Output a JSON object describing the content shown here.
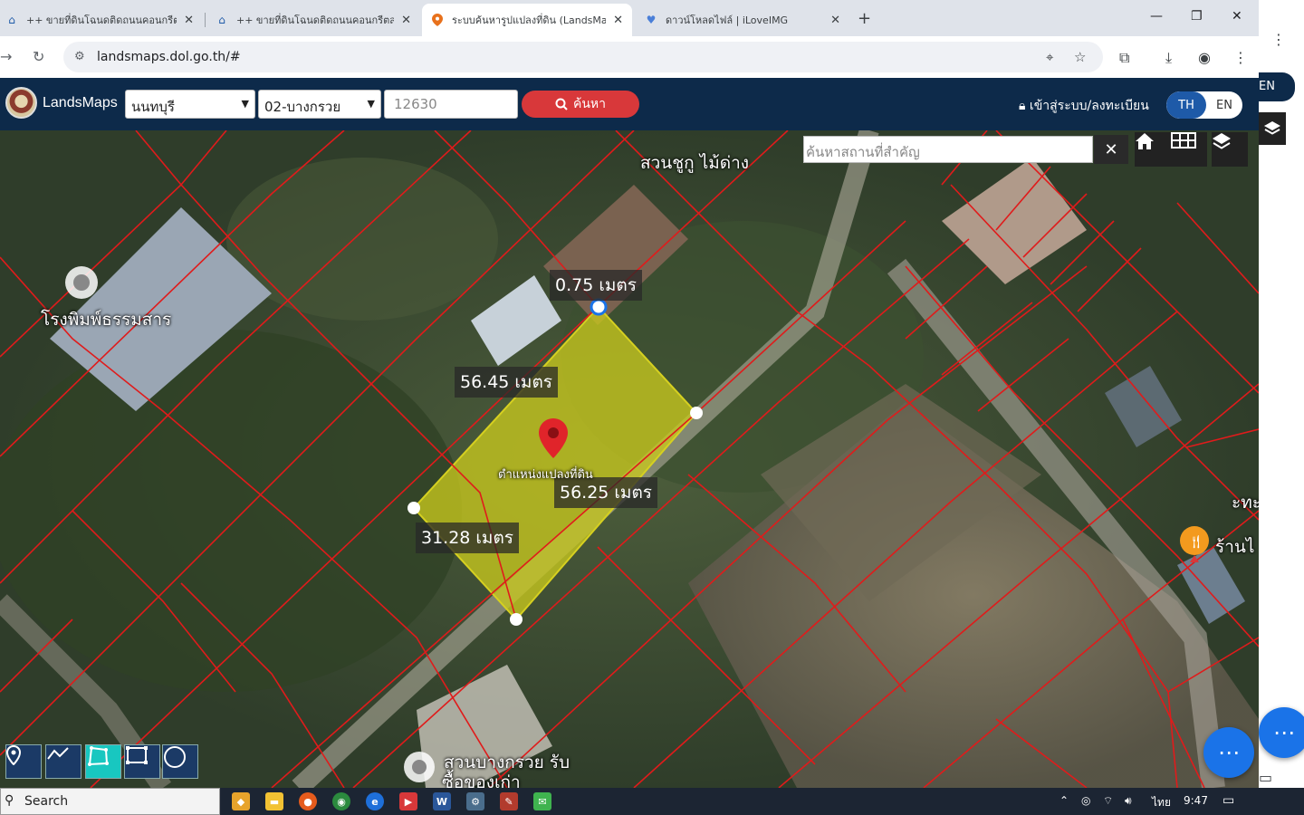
{
  "browser": {
    "tabs": [
      {
        "title": "++ ขายที่ดินโฉนดติดถนนคอนกรีตส",
        "icon": "home-icon"
      },
      {
        "title": "++ ขายที่ดินโฉนดติดถนนคอนกรีตส",
        "icon": "home-icon"
      },
      {
        "title": "ระบบค้นหารูปแปลงที่ดิน (LandsMap",
        "icon": "map-pin-icon"
      },
      {
        "title": "ดาวน์โหลดไฟล์ | iLoveIMG",
        "icon": "heart-icon"
      }
    ],
    "url": "landsmaps.dol.go.th/#"
  },
  "right_panel": {
    "lang": "EN"
  },
  "header": {
    "brand": "LandsMaps",
    "province": "นนทบุรี",
    "district": "02-บางกรวย",
    "zipcode": "12630",
    "search_label": "ค้นหา",
    "login_label": "เข้าสู่ระบบ/ลงทะเบียน",
    "lang_th": "TH",
    "lang_en": "EN"
  },
  "map": {
    "place_search_placeholder": "ค้นหาสถานที่สำคัญ",
    "measurements": {
      "top": "0.75 เมตร",
      "left": "56.45 เมตร",
      "right": "56.25 เมตร",
      "bottom": "31.28 เมตร"
    },
    "parcel_label": "ตำแหน่งแปลงที่ดิน",
    "pois": {
      "printing": "โรงพิมพ์ธรรมสาร",
      "garden_top": "สวนชูกู ไม้ด่าง",
      "garden_bottom_1": "สวนบางกรวย รับ",
      "garden_bottom_2": "ซื้อของเก่า",
      "shop": "ร้านไ",
      "edge_text": "ะทะ"
    },
    "parcel_color": "#c8c81e",
    "boundary_color": "#e01b1b"
  },
  "taskbar": {
    "search_label": "Search",
    "lang": "ไทย",
    "time": "9:47"
  }
}
